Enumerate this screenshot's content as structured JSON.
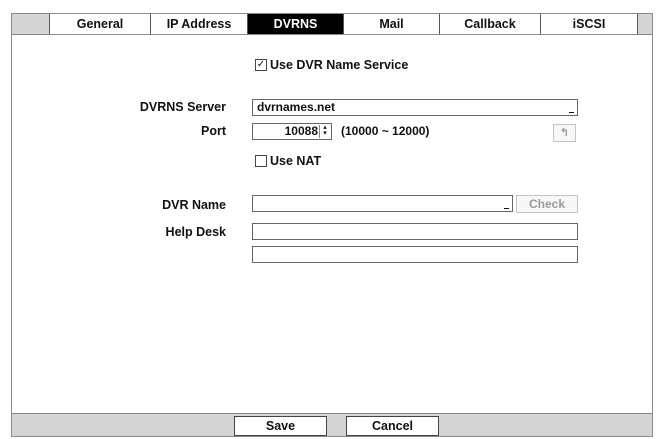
{
  "tabs": [
    {
      "label": "General",
      "active": false
    },
    {
      "label": "IP Address",
      "active": false
    },
    {
      "label": "DVRNS",
      "active": true
    },
    {
      "label": "Mail",
      "active": false
    },
    {
      "label": "Callback",
      "active": false
    },
    {
      "label": "iSCSI",
      "active": false
    }
  ],
  "form": {
    "use_dvrns": {
      "label": "Use DVR Name Service",
      "checked": true,
      "mark": "✓"
    },
    "server": {
      "label": "DVRNS Server",
      "value": "dvrnames.net"
    },
    "port": {
      "label": "Port",
      "value": "10088",
      "range": "(10000 ~ 12000)"
    },
    "use_nat": {
      "label": "Use NAT",
      "checked": false,
      "mark": ""
    },
    "dvr_name": {
      "label": "DVR Name",
      "value": "",
      "check_label": "Check"
    },
    "help_desk": {
      "label": "Help Desk",
      "line1": "",
      "line2": ""
    }
  },
  "icons": {
    "spinner_up": "▴",
    "spinner_down": "▾",
    "revert": "↰"
  },
  "footer": {
    "save_label": "Save",
    "cancel_label": "Cancel"
  }
}
